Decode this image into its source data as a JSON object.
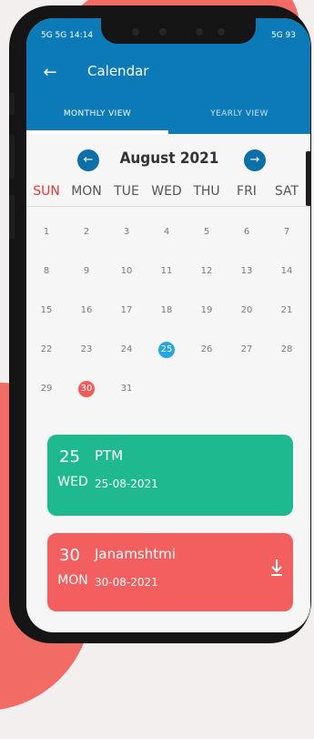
{
  "status": {
    "left": "5G 5G 14:14",
    "right": "5G 93"
  },
  "header": {
    "back_icon": "back-arrow-icon",
    "title": "Calendar"
  },
  "tabs": [
    {
      "label": "MONTHLY VIEW",
      "active": true
    },
    {
      "label": "YEARLY VIEW",
      "active": false
    }
  ],
  "calendar": {
    "month_label": "August 2021",
    "prev_icon": "chevron-left-icon",
    "next_icon": "chevron-right-icon",
    "weekdays": [
      "SUN",
      "MON",
      "TUE",
      "WED",
      "THU",
      "FRI",
      "SAT"
    ],
    "days": {
      "d1": "1",
      "d2": "2",
      "d3": "3",
      "d4": "4",
      "d5": "5",
      "d6": "6",
      "d7": "7",
      "d8": "8",
      "d9": "9",
      "d10": "10",
      "d11": "11",
      "d12": "12",
      "d13": "13",
      "d14": "14",
      "d15": "15",
      "d16": "16",
      "d17": "17",
      "d18": "18",
      "d19": "19",
      "d20": "20",
      "d21": "21",
      "d22": "22",
      "d23": "23",
      "d24": "24",
      "d25": "25",
      "d26": "26",
      "d27": "27",
      "d28": "28",
      "d29": "29",
      "d30": "30",
      "d31": "31"
    },
    "highlighted": {
      "today": "25",
      "holiday": "30"
    }
  },
  "events": [
    {
      "day_num": "25",
      "day_name": "WED",
      "title": "PTM",
      "date": "25-08-2021",
      "color": "#1eb98e"
    },
    {
      "day_num": "30",
      "day_name": "MON",
      "title": "Janamshtmi",
      "date": "30-08-2021",
      "color": "#f35e5f",
      "icon": "download-icon"
    }
  ],
  "colors": {
    "primary": "#0d7ab8",
    "sunday": "#e53935",
    "today": "#26a6e0",
    "holiday": "#f25b5b"
  }
}
